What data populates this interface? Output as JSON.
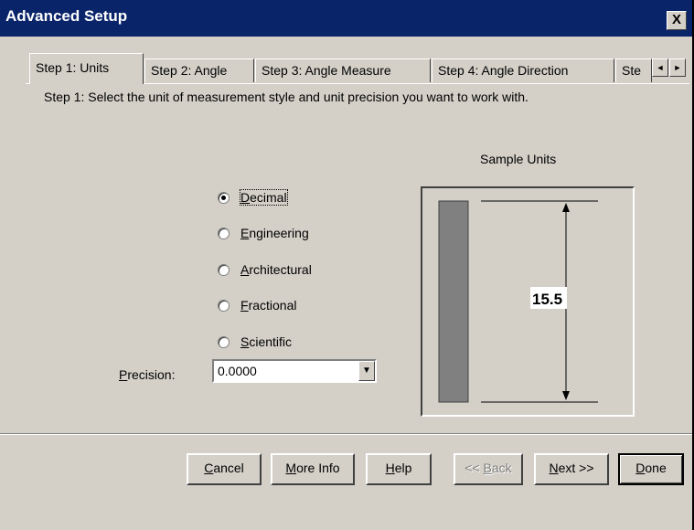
{
  "window": {
    "title": "Advanced Setup",
    "close_label": "X"
  },
  "tabs": [
    {
      "label": "Step 1: Units"
    },
    {
      "label": "Step 2: Angle"
    },
    {
      "label": "Step 3: Angle Measure"
    },
    {
      "label": "Step 4: Angle Direction"
    },
    {
      "label": "Ste"
    }
  ],
  "tab_scroll": {
    "left": "◄",
    "right": "►"
  },
  "instructions": "Step 1:  Select the unit of measurement style and unit precision you want to work with.",
  "units": {
    "options": [
      {
        "key": "D",
        "rest": "ecimal",
        "checked": true
      },
      {
        "key": "E",
        "rest": "ngineering",
        "checked": false
      },
      {
        "key": "A",
        "rest": "rchitectural",
        "checked": false
      },
      {
        "key": "F",
        "rest": "ractional",
        "checked": false
      },
      {
        "key": "S",
        "rest": "cientific",
        "checked": false
      }
    ]
  },
  "precision": {
    "label_key": "P",
    "label_rest": "recision:",
    "value": "0.0000"
  },
  "sample": {
    "label": "Sample Units",
    "value": "15.5"
  },
  "buttons": {
    "cancel": {
      "key": "C",
      "rest": "ancel"
    },
    "more_info": {
      "key": "M",
      "rest": "ore Info"
    },
    "help": {
      "key": "H",
      "rest": "elp"
    },
    "back": {
      "pre": "<< ",
      "key": "B",
      "rest": "ack"
    },
    "next": {
      "key": "N",
      "rest": "ext >>"
    },
    "done": {
      "key": "D",
      "rest": "one"
    }
  },
  "colors": {
    "title_bar": "#0a246a",
    "face": "#d4d0c8",
    "sample_bar": "#808080"
  }
}
